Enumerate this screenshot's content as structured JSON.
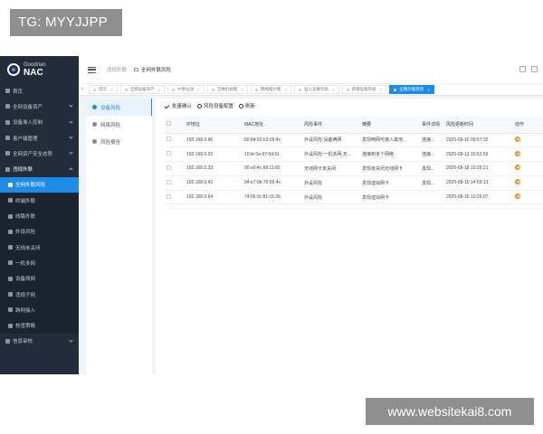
{
  "watermarks": {
    "top": "TG: MYYJJPP",
    "bottom": "www.websitekai8.com"
  },
  "brand": {
    "company": "Goodrian",
    "product": "NAC"
  },
  "sidebar": {
    "items": [
      {
        "label": "首页",
        "icon": "home-icon",
        "type": "top"
      },
      {
        "label": "全网设备资产",
        "icon": "devices-icon",
        "type": "group"
      },
      {
        "label": "设备准入控制",
        "icon": "shield-icon",
        "type": "group"
      },
      {
        "label": "客户端管理",
        "icon": "client-icon",
        "type": "group"
      },
      {
        "label": "全网资产安全态势",
        "icon": "security-icon",
        "type": "group"
      },
      {
        "label": "违规外联",
        "icon": "violation-icon",
        "type": "group-open"
      },
      {
        "label": "全网外联风险",
        "icon": "risk-icon",
        "type": "active"
      },
      {
        "label": "终端外联",
        "icon": "terminal-icon",
        "type": "sub"
      },
      {
        "label": "线路外联",
        "icon": "line-icon",
        "type": "sub"
      },
      {
        "label": "外设风险",
        "icon": "peripheral-icon",
        "type": "sub"
      },
      {
        "label": "无线未关闭",
        "icon": "wifi-icon",
        "type": "sub"
      },
      {
        "label": "一机多网",
        "icon": "multi-net-icon",
        "type": "sub"
      },
      {
        "label": "设备两网",
        "icon": "dual-net-icon",
        "type": "sub"
      },
      {
        "label": "违规子网",
        "icon": "subnet-icon",
        "type": "sub"
      },
      {
        "label": "跨网接入",
        "icon": "cross-net-icon",
        "type": "sub"
      },
      {
        "label": "核查策略",
        "icon": "policy-icon",
        "type": "sub"
      },
      {
        "label": "信息审核",
        "icon": "audit-icon",
        "type": "group"
      }
    ]
  },
  "header": {
    "breadcrumb_parent": "违规外联",
    "breadcrumb_current": "全网外联风险"
  },
  "tabs": [
    {
      "label": "首页",
      "active": false
    },
    {
      "label": "全网设备资产",
      "active": false
    },
    {
      "label": "IP地址池",
      "active": false
    },
    {
      "label": "交换机视图",
      "active": false
    },
    {
      "label": "网络拓扑图",
      "active": false
    },
    {
      "label": "准入设备列表",
      "active": false
    },
    {
      "label": "新增设备列表",
      "active": false
    },
    {
      "label": "全网外联风险",
      "active": true
    }
  ],
  "subpanel": [
    {
      "label": "设备风险",
      "active": true
    },
    {
      "label": "网络风险",
      "active": false
    },
    {
      "label": "风险报告",
      "active": false
    }
  ],
  "toolbar": {
    "batch_confirm": "批量确认",
    "risk_config": "风险设备配置",
    "refresh": "刷新"
  },
  "table": {
    "columns": [
      "IP地址",
      "MAC地址",
      "风险事件",
      "摘要",
      "事件详情",
      "风险更新时间",
      "动作"
    ],
    "rows": [
      {
        "ip": "192.168.0.96",
        "mac": "50:84:92:b3:05:4c",
        "event": "外设风险:设备两网",
        "summary": "发现两网可接入其他...",
        "detail": "连接...",
        "time": "2025-09-15 09:57:32"
      },
      {
        "ip": "192.168.0.20",
        "mac": "10:fe:0a:97:0d:61",
        "event": "外设风险:一机多网,无...",
        "summary": "连接到多个网络",
        "detail": "连接...",
        "time": "2025-09-13 10:52:56"
      },
      {
        "ip": "192.168.0.33",
        "mac": "00:e0:4c:68:11:82",
        "event": "无线网卡未关闭",
        "summary": "发现未关闭无线网卡",
        "detail": "发现...",
        "time": "2025-08-18 10:25:21"
      },
      {
        "ip": "192.168.0.42",
        "mac": "94:e7:0b:76:65:4c",
        "event": "外设风险",
        "summary": "发现虚拟网卡",
        "detail": "发现...",
        "time": "2025-08-15 14:59:13"
      },
      {
        "ip": "192.168.0.64",
        "mac": "74:56:3c:81:c5:2b",
        "event": "外设风险",
        "summary": "发现虚拟网卡",
        "detail": "",
        "time": "2025-08-15 10:26:07"
      }
    ]
  },
  "colors": {
    "sidebar_bg": "#232c3b",
    "accent": "#1e8ce6",
    "action": "#f08c12"
  }
}
